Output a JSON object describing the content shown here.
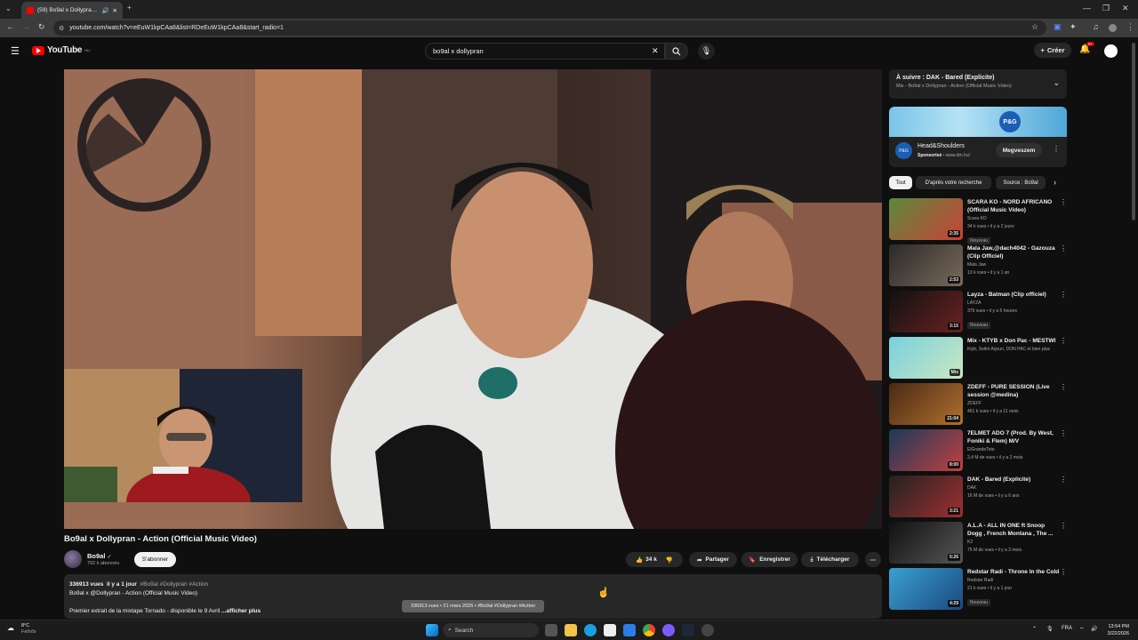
{
  "browser": {
    "tab_title": "(59) Bo9al x Dollypran - Action",
    "new_tab": "+",
    "url": "youtube.com/watch?v=eEuW1kpCAa8&list=RDeEuW1kpCAa8&start_radio=1"
  },
  "header": {
    "logo": "YouTube",
    "logo_region": "HU",
    "search_value": "bo9al x dollypran",
    "create_label": "Créer",
    "notif_count": "9+"
  },
  "video": {
    "title": "Bo9al x Dollypran - Action (Official Music Video)",
    "channel": "Bo9al",
    "subscribers": "792 k abonnés",
    "subscribe_label": "S'abonner",
    "likes": "34 k",
    "share_label": "Partager",
    "save_label": "Enregistrer",
    "download_label": "Télécharger",
    "desc_views": "336913 vues",
    "desc_age": "il y a 1 jour",
    "desc_tags": "#Bo9al #Dollypran #Action",
    "desc_line2": "Bo9al x @Dollypran - Action (Official Music Video)",
    "desc_line3": "Premier extrait de la mixtape Tornado - disponible le 9 Avril",
    "show_more": "...afficher plus",
    "tooltip": "336913 vues • 21 mars 2026 • #Bo9al #Dollypran #Action"
  },
  "sidebar": {
    "upnext_title": "À suivre : DAK - Bared (Explicite)",
    "upnext_sub": "Mix - Bo9al x Dollypran - Action (Official Music Video)",
    "ad": {
      "logo_text": "P&G",
      "name": "Head&Shoulders",
      "sponsored": "Sponsorisé",
      "domain": "www.dm.hu/",
      "cta": "Megveszem"
    },
    "chips": [
      "Tout",
      "D'après votre recherche",
      "Source : Bo9al"
    ],
    "recs": [
      {
        "title": "SCARA KO - NORD AFRICANO (Official Music Video)",
        "channel": "Scara KO",
        "meta": "34 k vues • il y a 2 jours",
        "badge": "Nouveau",
        "duration": "2:35"
      },
      {
        "title": "Mala Jaw,@dach4042 - Gazouza (Clip Officiel)",
        "channel": "Mala Jaw",
        "meta": "13 k vues • il y a 1 an",
        "badge": "",
        "duration": "2:53"
      },
      {
        "title": "Layza - Batman (Clip officiel)",
        "channel": "LAYZA",
        "meta": "379 vues • il y a 5 heures",
        "badge": "Nouveau",
        "duration": "3:15"
      },
      {
        "title": "Mix - KTYB x Don Pac - MESTWI",
        "channel": "Ktyb, Selim Arjoun, DON PAC et bien plus",
        "meta": "",
        "badge": "",
        "duration": "Mix"
      },
      {
        "title": "ZDEFF - PURE SESSION (Live session @medina)",
        "channel": "ZDEFF",
        "meta": "461 k vues • il y a 11 mois",
        "badge": "",
        "duration": "21:04"
      },
      {
        "title": "7ELMET ADO 7 (Prod. By West, Foniki & Flem) M/V",
        "channel": "ElGrandeToto",
        "meta": "2,4 M de vues • il y a 2 mois",
        "badge": "",
        "duration": "8:00"
      },
      {
        "title": "DAK - Bared (Explicite)",
        "channel": "DAK",
        "meta": "16 M de vues • il y a 6 ans",
        "badge": "",
        "duration": "3:21"
      },
      {
        "title": "A.L.A - ALL IN ONE ft Snoop Dogg , French Montana , The ...",
        "channel": "K2",
        "meta": "75 M de vues • il y a 2 mois",
        "badge": "",
        "duration": "5:26"
      },
      {
        "title": "Redstar Radi - Throne In the Cold",
        "channel": "Redstar Radi",
        "meta": "21 k vues • il y a 1 jour",
        "badge": "Nouveau",
        "duration": "4:29"
      }
    ]
  },
  "taskbar": {
    "weather_temp": "8°C",
    "weather_desc": "Felhős",
    "search_label": "Search",
    "lang": "FRA",
    "time": "13:54 PM",
    "date": "3/22/2026"
  }
}
